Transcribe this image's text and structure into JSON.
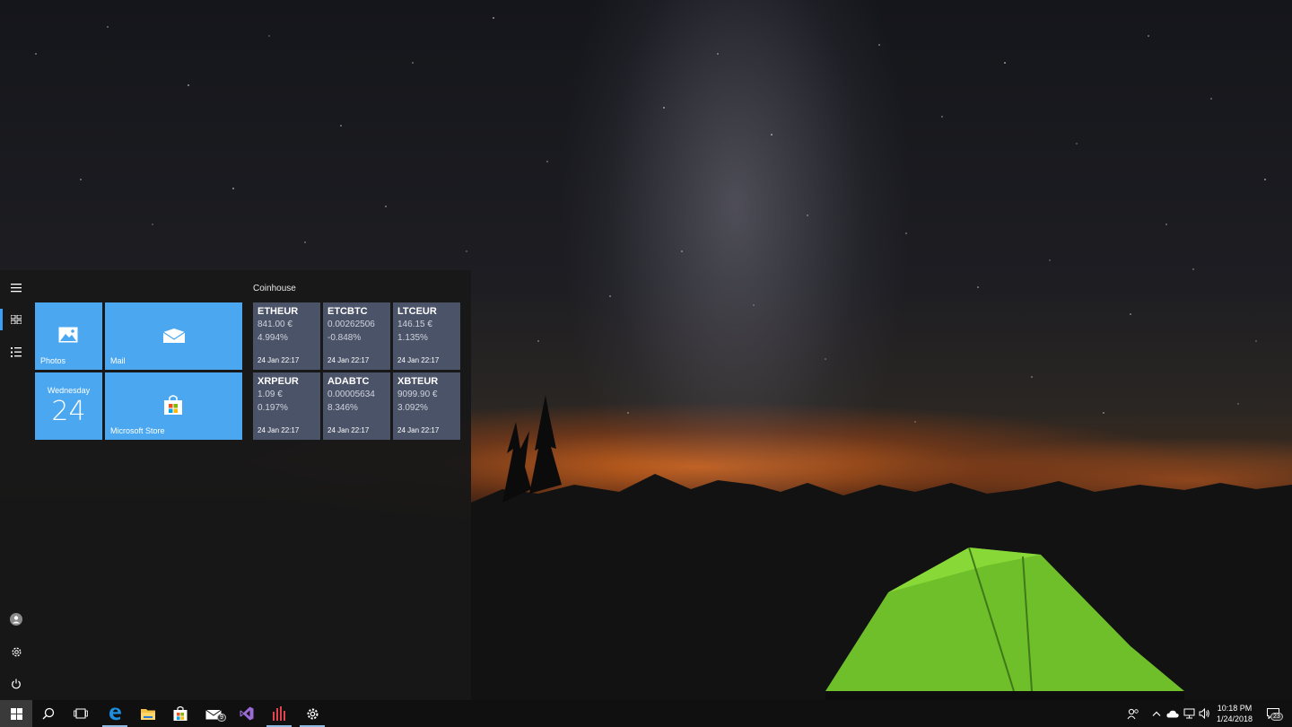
{
  "start_menu": {
    "group_title": "Coinhouse",
    "tiles": {
      "photos": "Photos",
      "mail": "Mail",
      "calendar_day": "Wednesday",
      "calendar_date": "24",
      "store": "Microsoft Store"
    },
    "coins": [
      {
        "pair": "ETHEUR",
        "price": "841.00 €",
        "change": "4.994%",
        "time": "24 Jan 22:17"
      },
      {
        "pair": "ETCBTC",
        "price": "0.00262506",
        "change": "-0.848%",
        "time": "24 Jan 22:17"
      },
      {
        "pair": "LTCEUR",
        "price": "146.15 €",
        "change": "1.135%",
        "time": "24 Jan 22:17"
      },
      {
        "pair": "XRPEUR",
        "price": "1.09 €",
        "change": "0.197%",
        "time": "24 Jan 22:17"
      },
      {
        "pair": "ADABTC",
        "price": "0.00005634",
        "change": "8.346%",
        "time": "24 Jan 22:17"
      },
      {
        "pair": "XBTEUR",
        "price": "9099.90 €",
        "change": "3.092%",
        "time": "24 Jan 22:17"
      }
    ]
  },
  "taskbar": {
    "apps": [
      "search-icon",
      "task-view-icon",
      "edge-icon",
      "file-explorer-icon",
      "store-icon",
      "mail-icon",
      "visual-studio-icon",
      "coinhouse-icon",
      "settings-icon"
    ],
    "mail_badge": "9",
    "clock_time": "10:18 PM",
    "clock_date": "1/24/2018",
    "notification_count": "23"
  },
  "colors": {
    "tile_blue": "#4ba8f0",
    "coin_tile": "#4b5368",
    "accent": "#3aa0f3"
  }
}
